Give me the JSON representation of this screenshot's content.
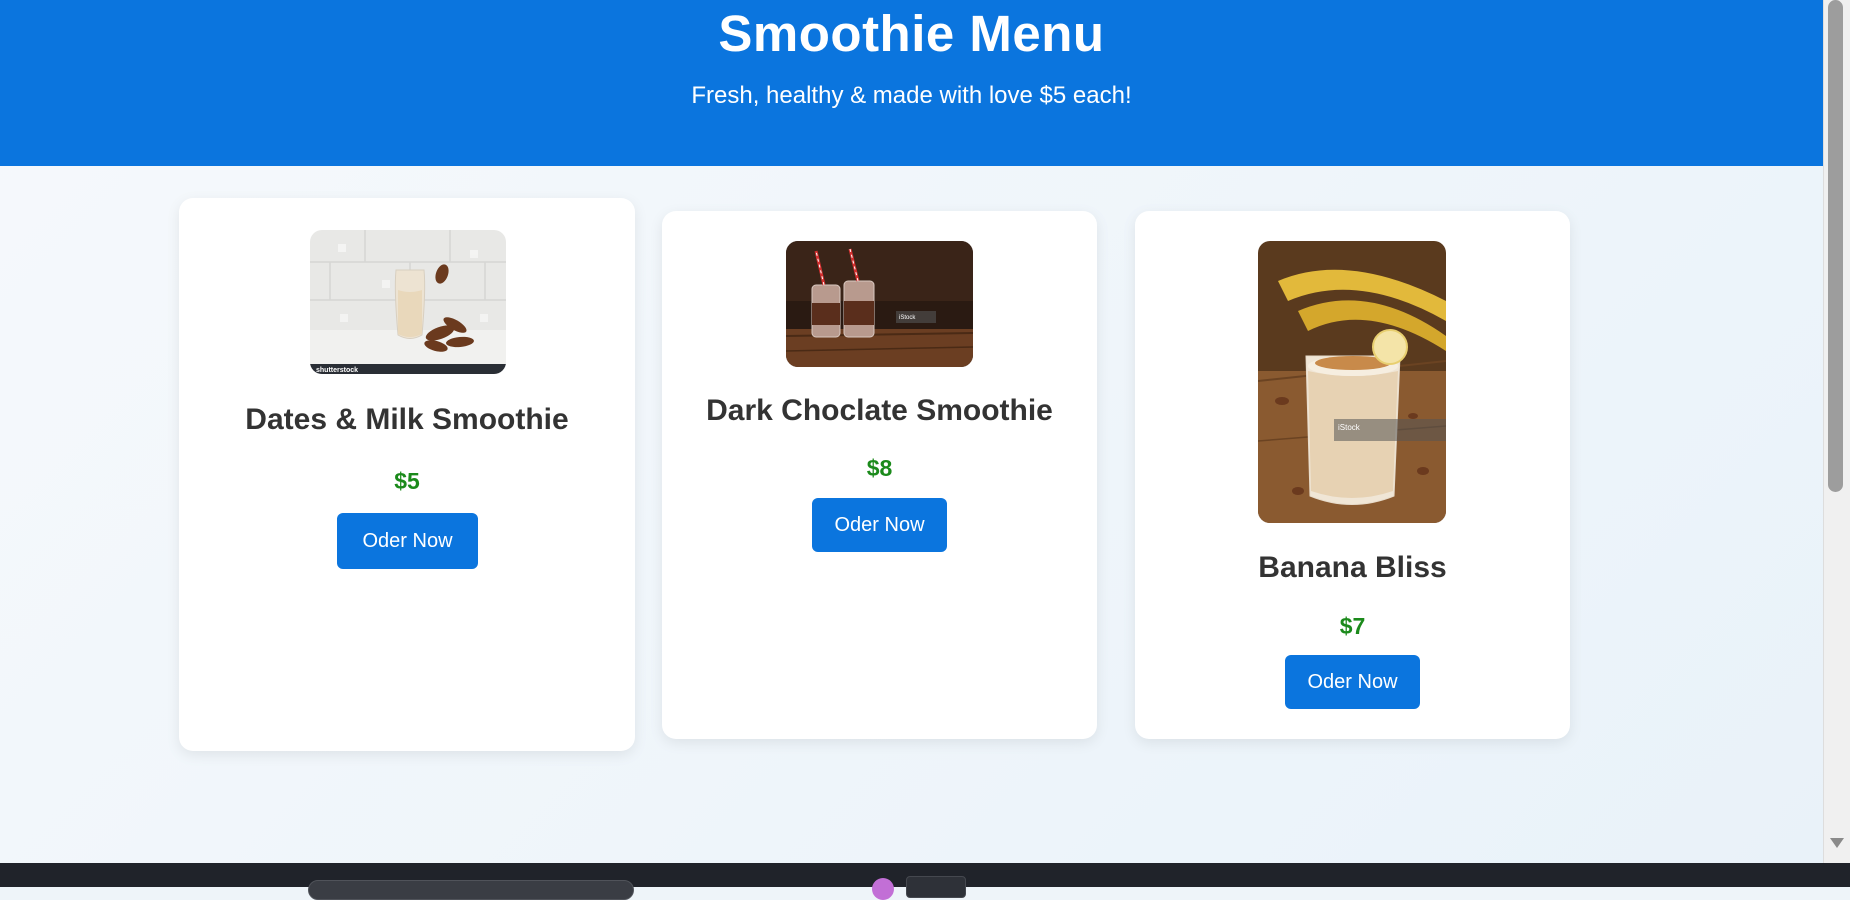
{
  "header": {
    "title": "Smoothie Menu",
    "subtitle": "Fresh, healthy & made with love $5 each!"
  },
  "products": [
    {
      "name": "Dates & Milk Smoothie",
      "price": "$5",
      "button_label": "Oder Now",
      "image_watermark": "shutterstock"
    },
    {
      "name": "Dark Choclate Smoothie",
      "price": "$8",
      "button_label": "Oder Now",
      "image_watermark": "iStock"
    },
    {
      "name": "Banana Bliss",
      "price": "$7",
      "button_label": "Oder Now",
      "image_watermark": "iStock"
    }
  ],
  "colors": {
    "header_bg": "#0b75de",
    "button_bg": "#0b75de",
    "price": "#1b8a1b",
    "product_name": "#333333"
  }
}
